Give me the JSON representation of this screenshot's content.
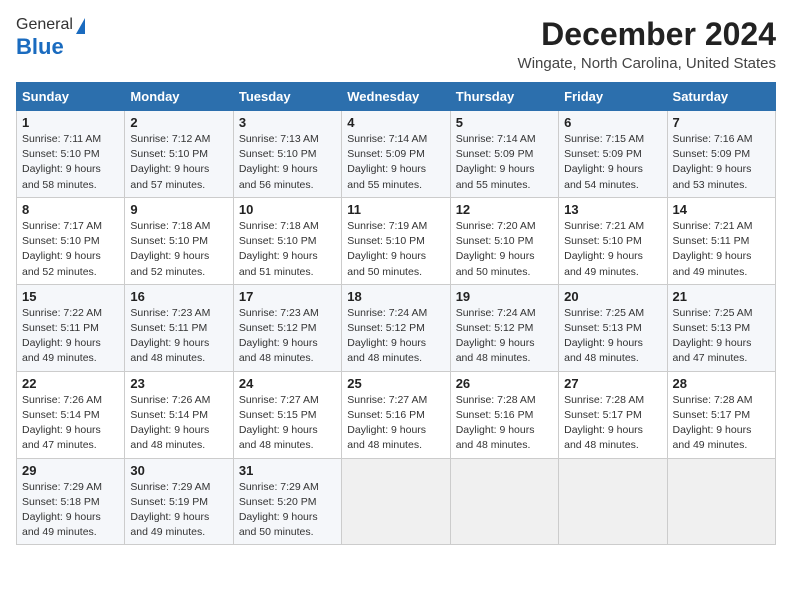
{
  "header": {
    "logo_general": "General",
    "logo_blue": "Blue",
    "month_title": "December 2024",
    "location": "Wingate, North Carolina, United States"
  },
  "calendar": {
    "days_of_week": [
      "Sunday",
      "Monday",
      "Tuesday",
      "Wednesday",
      "Thursday",
      "Friday",
      "Saturday"
    ],
    "weeks": [
      [
        {
          "day": "1",
          "sunrise": "7:11 AM",
          "sunset": "5:10 PM",
          "daylight": "9 hours and 58 minutes."
        },
        {
          "day": "2",
          "sunrise": "7:12 AM",
          "sunset": "5:10 PM",
          "daylight": "9 hours and 57 minutes."
        },
        {
          "day": "3",
          "sunrise": "7:13 AM",
          "sunset": "5:10 PM",
          "daylight": "9 hours and 56 minutes."
        },
        {
          "day": "4",
          "sunrise": "7:14 AM",
          "sunset": "5:09 PM",
          "daylight": "9 hours and 55 minutes."
        },
        {
          "day": "5",
          "sunrise": "7:14 AM",
          "sunset": "5:09 PM",
          "daylight": "9 hours and 55 minutes."
        },
        {
          "day": "6",
          "sunrise": "7:15 AM",
          "sunset": "5:09 PM",
          "daylight": "9 hours and 54 minutes."
        },
        {
          "day": "7",
          "sunrise": "7:16 AM",
          "sunset": "5:09 PM",
          "daylight": "9 hours and 53 minutes."
        }
      ],
      [
        {
          "day": "8",
          "sunrise": "7:17 AM",
          "sunset": "5:10 PM",
          "daylight": "9 hours and 52 minutes."
        },
        {
          "day": "9",
          "sunrise": "7:18 AM",
          "sunset": "5:10 PM",
          "daylight": "9 hours and 52 minutes."
        },
        {
          "day": "10",
          "sunrise": "7:18 AM",
          "sunset": "5:10 PM",
          "daylight": "9 hours and 51 minutes."
        },
        {
          "day": "11",
          "sunrise": "7:19 AM",
          "sunset": "5:10 PM",
          "daylight": "9 hours and 50 minutes."
        },
        {
          "day": "12",
          "sunrise": "7:20 AM",
          "sunset": "5:10 PM",
          "daylight": "9 hours and 50 minutes."
        },
        {
          "day": "13",
          "sunrise": "7:21 AM",
          "sunset": "5:10 PM",
          "daylight": "9 hours and 49 minutes."
        },
        {
          "day": "14",
          "sunrise": "7:21 AM",
          "sunset": "5:11 PM",
          "daylight": "9 hours and 49 minutes."
        }
      ],
      [
        {
          "day": "15",
          "sunrise": "7:22 AM",
          "sunset": "5:11 PM",
          "daylight": "9 hours and 49 minutes."
        },
        {
          "day": "16",
          "sunrise": "7:23 AM",
          "sunset": "5:11 PM",
          "daylight": "9 hours and 48 minutes."
        },
        {
          "day": "17",
          "sunrise": "7:23 AM",
          "sunset": "5:12 PM",
          "daylight": "9 hours and 48 minutes."
        },
        {
          "day": "18",
          "sunrise": "7:24 AM",
          "sunset": "5:12 PM",
          "daylight": "9 hours and 48 minutes."
        },
        {
          "day": "19",
          "sunrise": "7:24 AM",
          "sunset": "5:12 PM",
          "daylight": "9 hours and 48 minutes."
        },
        {
          "day": "20",
          "sunrise": "7:25 AM",
          "sunset": "5:13 PM",
          "daylight": "9 hours and 48 minutes."
        },
        {
          "day": "21",
          "sunrise": "7:25 AM",
          "sunset": "5:13 PM",
          "daylight": "9 hours and 47 minutes."
        }
      ],
      [
        {
          "day": "22",
          "sunrise": "7:26 AM",
          "sunset": "5:14 PM",
          "daylight": "9 hours and 47 minutes."
        },
        {
          "day": "23",
          "sunrise": "7:26 AM",
          "sunset": "5:14 PM",
          "daylight": "9 hours and 48 minutes."
        },
        {
          "day": "24",
          "sunrise": "7:27 AM",
          "sunset": "5:15 PM",
          "daylight": "9 hours and 48 minutes."
        },
        {
          "day": "25",
          "sunrise": "7:27 AM",
          "sunset": "5:16 PM",
          "daylight": "9 hours and 48 minutes."
        },
        {
          "day": "26",
          "sunrise": "7:28 AM",
          "sunset": "5:16 PM",
          "daylight": "9 hours and 48 minutes."
        },
        {
          "day": "27",
          "sunrise": "7:28 AM",
          "sunset": "5:17 PM",
          "daylight": "9 hours and 48 minutes."
        },
        {
          "day": "28",
          "sunrise": "7:28 AM",
          "sunset": "5:17 PM",
          "daylight": "9 hours and 49 minutes."
        }
      ],
      [
        {
          "day": "29",
          "sunrise": "7:29 AM",
          "sunset": "5:18 PM",
          "daylight": "9 hours and 49 minutes."
        },
        {
          "day": "30",
          "sunrise": "7:29 AM",
          "sunset": "5:19 PM",
          "daylight": "9 hours and 49 minutes."
        },
        {
          "day": "31",
          "sunrise": "7:29 AM",
          "sunset": "5:20 PM",
          "daylight": "9 hours and 50 minutes."
        },
        null,
        null,
        null,
        null
      ]
    ]
  }
}
